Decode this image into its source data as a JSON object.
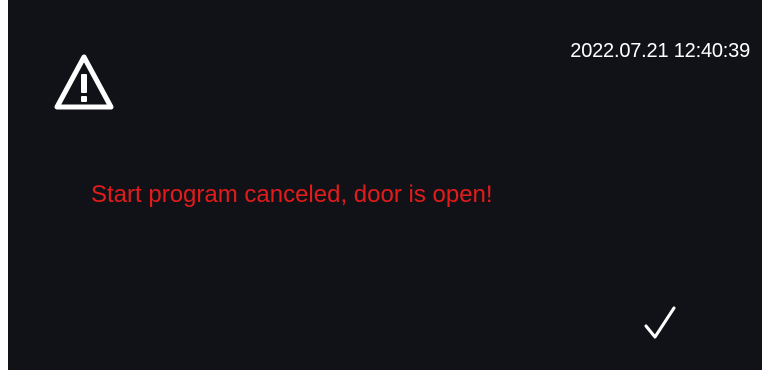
{
  "status_bar": {
    "datetime": "2022.07.21  12:40:39"
  },
  "dialog": {
    "icon": "warning-triangle-icon",
    "message": "Start program canceled, door is open!",
    "confirm_icon": "checkmark-icon"
  },
  "colors": {
    "background": "#111218",
    "message_text": "#e21b1b",
    "foreground": "#ffffff"
  }
}
